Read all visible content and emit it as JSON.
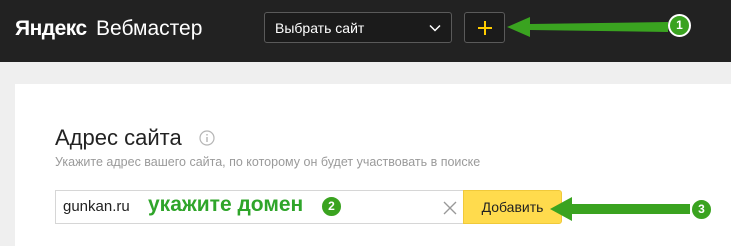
{
  "header": {
    "logo_brand": "Яндекс",
    "logo_product": "Вебмастер",
    "site_select_label": "Выбрать сайт",
    "add_site_symbol": "+"
  },
  "form": {
    "title": "Адрес сайта",
    "hint": "Укажите адрес вашего сайта, по которому он будет участвовать в поиске",
    "domain_value": "gunkan.ru",
    "add_button_label": "Добавить"
  },
  "annotations": {
    "domain_text": "укажите домен",
    "badge_1": "1",
    "badge_2": "2",
    "badge_3": "3"
  },
  "colors": {
    "header_bg": "#222222",
    "accent_yellow": "#ffdb4d",
    "annotation_green": "#3aa320"
  },
  "icons": [
    "chevron-down-icon",
    "plus-icon",
    "info-icon",
    "clear-icon"
  ]
}
